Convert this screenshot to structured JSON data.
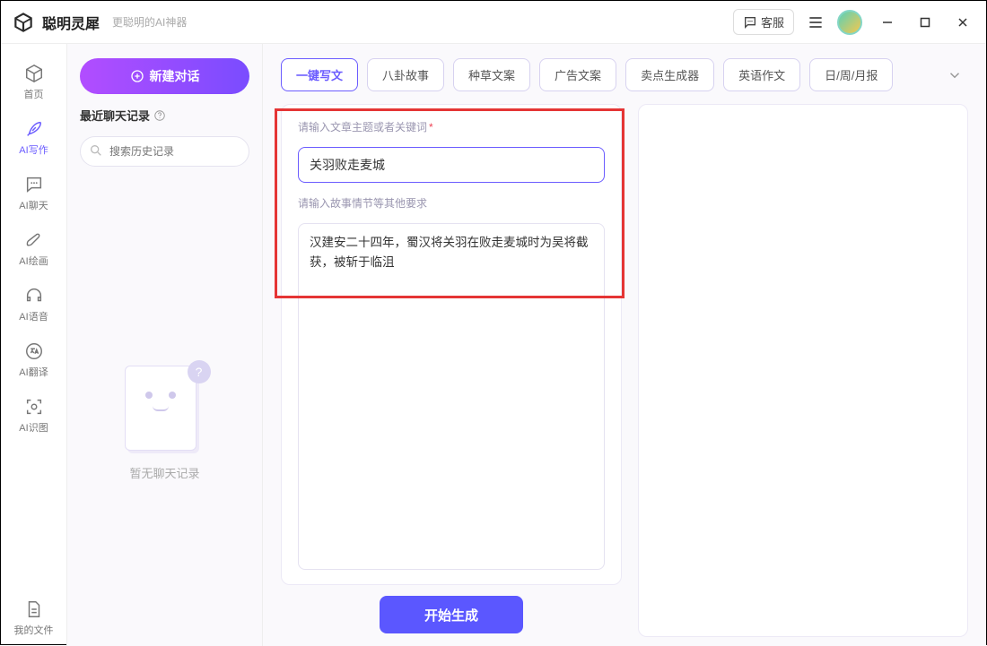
{
  "titlebar": {
    "app_name": "聪明灵犀",
    "app_sub": "更聪明的AI神器",
    "customer_service": "客服"
  },
  "nav": {
    "items": [
      {
        "label": "首页"
      },
      {
        "label": "AI写作"
      },
      {
        "label": "AI聊天"
      },
      {
        "label": "AI绘画"
      },
      {
        "label": "AI语音"
      },
      {
        "label": "AI翻译"
      },
      {
        "label": "AI识图"
      }
    ],
    "bottom": {
      "label": "我的文件"
    }
  },
  "history": {
    "new_chat": "新建对话",
    "title": "最近聊天记录",
    "search_placeholder": "搜索历史记录",
    "empty_text": "暂无聊天记录"
  },
  "tabs": [
    {
      "label": "一键写文",
      "active": true
    },
    {
      "label": "八卦故事"
    },
    {
      "label": "种草文案"
    },
    {
      "label": "广告文案"
    },
    {
      "label": "卖点生成器"
    },
    {
      "label": "英语作文"
    },
    {
      "label": "日/周/月报"
    }
  ],
  "form": {
    "topic_label": "请输入文章主题或者关键词",
    "topic_value": "关羽败走麦城",
    "detail_label": "请输入故事情节等其他要求",
    "detail_value": "汉建安二十四年，蜀汉将关羽在败走麦城时为吴将截获，被斩于临沮",
    "generate_label": "开始生成"
  }
}
